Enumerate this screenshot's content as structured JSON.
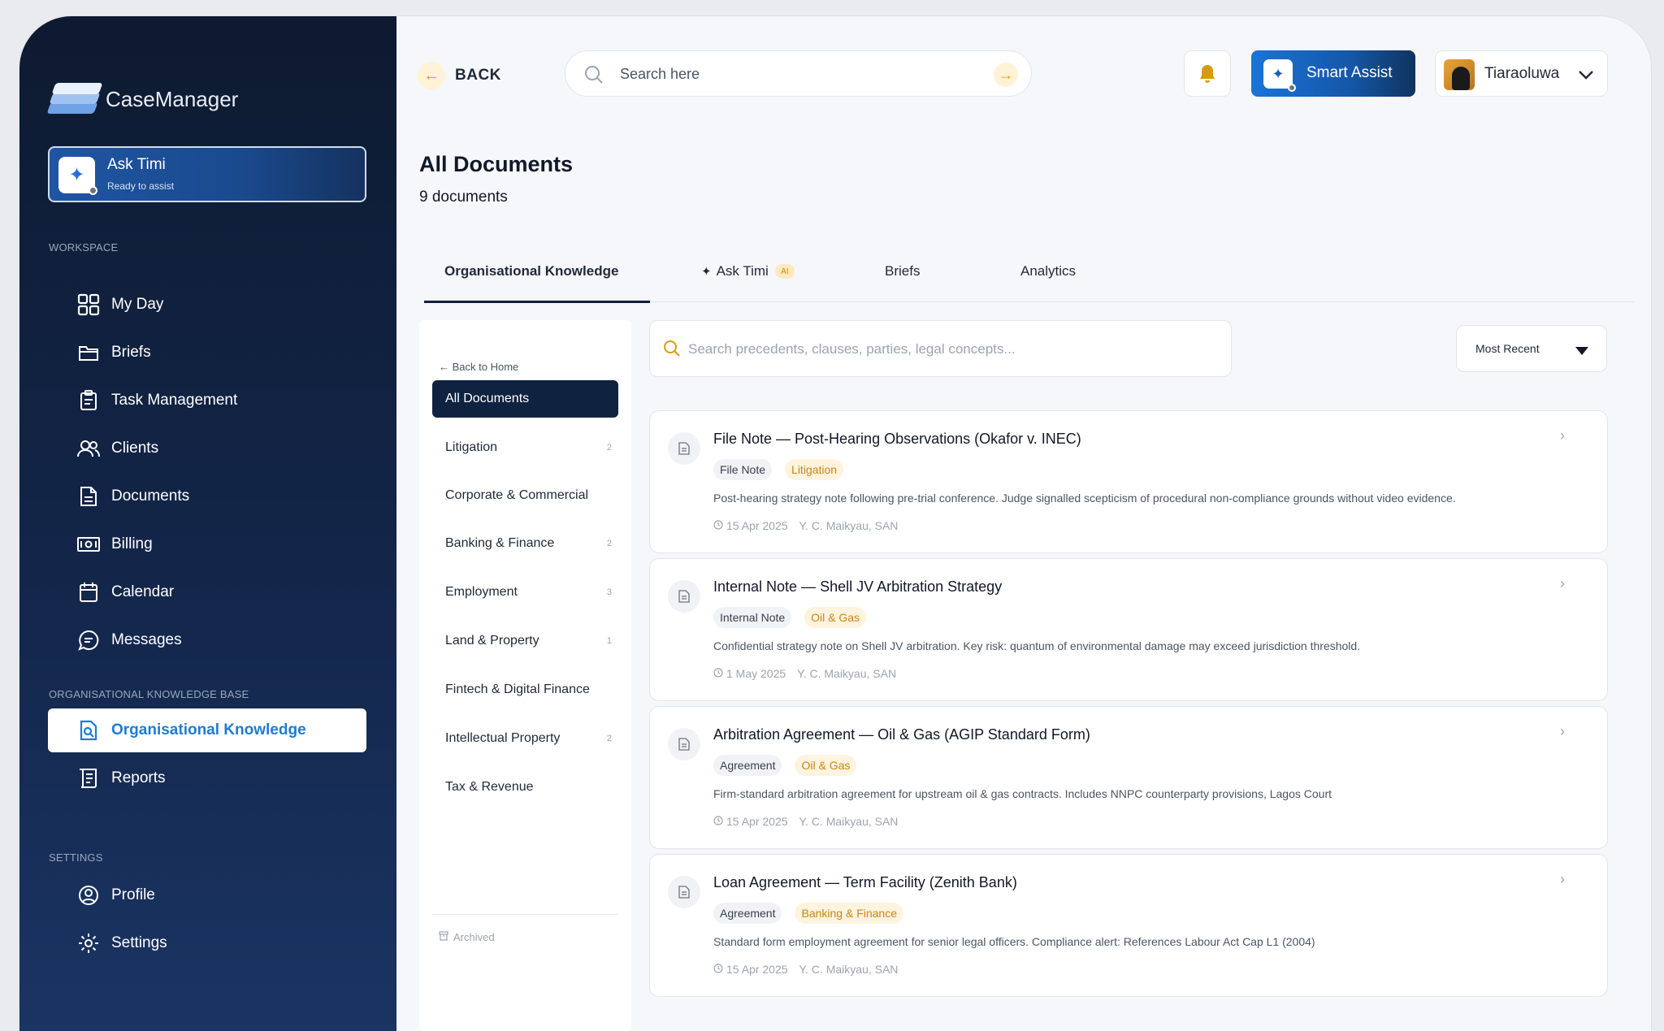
{
  "app": {
    "name": "CaseManager"
  },
  "ask_timi": {
    "title": "Ask Timi",
    "subtitle": "Ready to assist"
  },
  "sidebar": {
    "workspace_label": "WORKSPACE",
    "workspace_items": [
      {
        "label": "My Day",
        "icon": "grid-icon"
      },
      {
        "label": "Briefs",
        "icon": "folder-icon"
      },
      {
        "label": "Task Management",
        "icon": "clipboard-icon"
      },
      {
        "label": "Clients",
        "icon": "users-icon"
      },
      {
        "label": "Documents",
        "icon": "document-icon"
      },
      {
        "label": "Billing",
        "icon": "banknote-icon"
      },
      {
        "label": "Calendar",
        "icon": "calendar-icon"
      },
      {
        "label": "Messages",
        "icon": "message-icon"
      }
    ],
    "kb_label": "ORGANISATIONAL KNOWLEDGE BASE",
    "kb_items": [
      {
        "label": "Organisational Knowledge",
        "icon": "knowledge-icon",
        "active": true
      },
      {
        "label": "Reports",
        "icon": "reports-icon"
      }
    ],
    "settings_label": "SETTINGS",
    "settings_items": [
      {
        "label": "Profile",
        "icon": "profile-icon"
      },
      {
        "label": "Settings",
        "icon": "gear-icon"
      }
    ]
  },
  "topbar": {
    "back_label": "BACK",
    "search_placeholder": "Search here",
    "smart_assist_label": "Smart Assist",
    "user_name": "Tiaraoluwa"
  },
  "page": {
    "title": "All Documents",
    "count": "9 documents"
  },
  "tabs": [
    {
      "label": "Organisational Knowledge",
      "active": true
    },
    {
      "label": "Ask Timi",
      "badge": "AI"
    },
    {
      "label": "Briefs"
    },
    {
      "label": "Analytics"
    }
  ],
  "filters": {
    "back_home": "← Back to Home",
    "items": [
      {
        "label": "All Documents",
        "count": "",
        "active": true
      },
      {
        "label": "Litigation",
        "count": "2"
      },
      {
        "label": "Corporate & Commercial",
        "count": ""
      },
      {
        "label": "Banking & Finance",
        "count": "2"
      },
      {
        "label": "Employment",
        "count": "3"
      },
      {
        "label": "Land & Property",
        "count": "1"
      },
      {
        "label": "Fintech & Digital Finance",
        "count": ""
      },
      {
        "label": "Intellectual Property",
        "count": "2"
      },
      {
        "label": "Tax & Revenue",
        "count": ""
      }
    ],
    "archived": "Archived"
  },
  "doc_search": {
    "placeholder": "Search precedents, clauses, parties, legal concepts..."
  },
  "sort": {
    "selected": "Most Recent"
  },
  "documents": [
    {
      "title": "File Note — Post-Hearing Observations (Okafor v. INEC)",
      "type": "File Note",
      "category": "Litigation",
      "description": "Post-hearing strategy note following pre-trial conference. Judge signalled scepticism of procedural non-compliance grounds without video evidence.",
      "date": "15 Apr 2025",
      "author": "Y. C. Maikyau, SAN"
    },
    {
      "title": "Internal Note — Shell JV Arbitration Strategy",
      "type": "Internal Note",
      "category": "Oil & Gas",
      "description": "Confidential strategy note on Shell JV arbitration. Key risk: quantum of environmental damage may exceed jurisdiction threshold.",
      "date": "1 May 2025",
      "author": "Y. C. Maikyau, SAN"
    },
    {
      "title": "Arbitration Agreement — Oil & Gas (AGIP Standard Form)",
      "type": "Agreement",
      "category": "Oil & Gas",
      "description": "Firm-standard arbitration agreement for upstream oil & gas contracts. Includes NNPC counterparty provisions, Lagos Court",
      "date": "15 Apr 2025",
      "author": "Y. C. Maikyau, SAN"
    },
    {
      "title": "Loan Agreement — Term Facility (Zenith Bank)",
      "type": "Agreement",
      "category": "Banking & Finance",
      "description": "Standard form employment agreement for senior legal officers. Compliance alert: References Labour Act Cap L1 (2004)",
      "date": "15 Apr 2025",
      "author": "Y. C. Maikyau, SAN"
    }
  ],
  "colors": {
    "sidebar": "#13264a",
    "accent": "#1f7bd4",
    "gold": "#d99b0e"
  }
}
